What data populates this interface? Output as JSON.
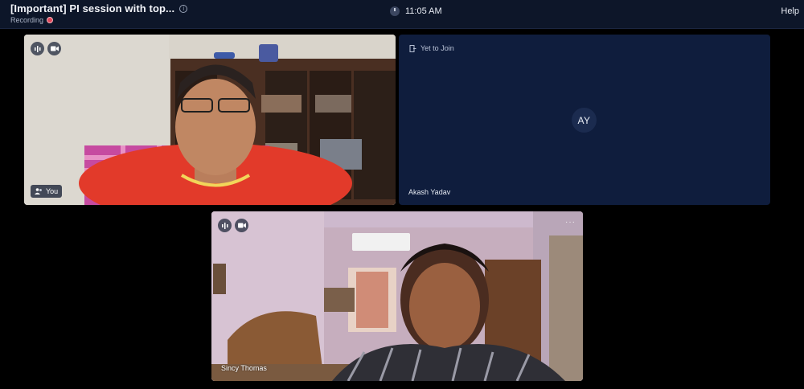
{
  "header": {
    "title": "[Important] PI session with top...",
    "recording_label": "Recording",
    "time": "11:05 AM",
    "help_label": "Help"
  },
  "participants": {
    "self": {
      "label": "You"
    },
    "akash": {
      "status": "Yet to Join",
      "initials": "AY",
      "name": "Akash Yadav"
    },
    "sincy": {
      "name": "Sincy Thomas",
      "menu": "···"
    }
  },
  "colors": {
    "topbar": "#0d1629",
    "tile_bg": "#0f1d3d",
    "recording_dot": "#e0485a"
  }
}
